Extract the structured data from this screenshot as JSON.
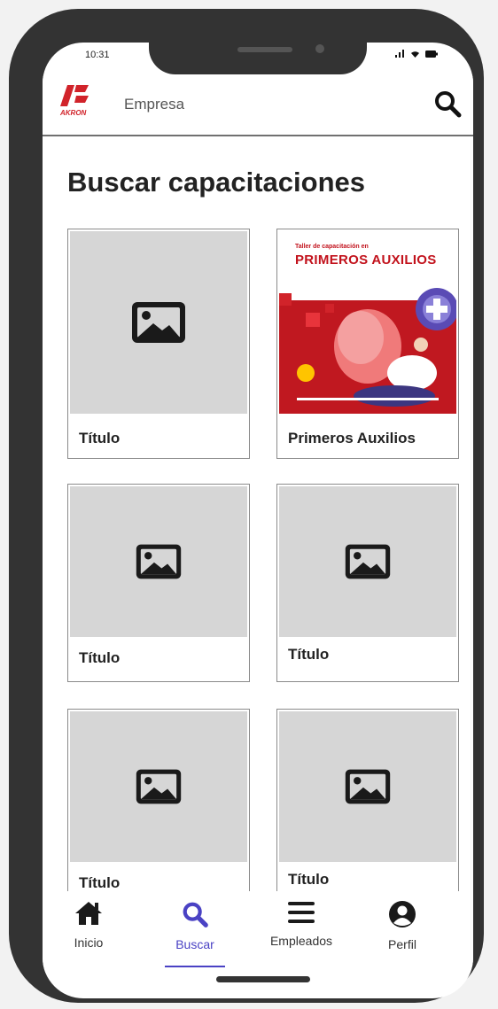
{
  "status_bar": {
    "time": "10:31"
  },
  "header": {
    "company": "Empresa",
    "logo_text": "AKRON"
  },
  "page": {
    "title": "Buscar capacitaciones"
  },
  "cards": [
    {
      "title": "Título"
    },
    {
      "title": "Primeros Auxilios",
      "poster_subtitle": "Taller de capacitación en",
      "poster_title": "PRIMEROS AUXILIOS"
    },
    {
      "title": "Título"
    },
    {
      "title": "Título"
    },
    {
      "title": "Título"
    },
    {
      "title": "Título"
    }
  ],
  "nav": {
    "items": [
      {
        "label": "Inicio",
        "icon": "home-icon"
      },
      {
        "label": "Buscar",
        "icon": "search-icon",
        "active": true
      },
      {
        "label": "Empleados",
        "icon": "list-icon"
      },
      {
        "label": "Perfil",
        "icon": "profile-icon"
      }
    ]
  },
  "colors": {
    "accent": "#4a42c4",
    "brand_red": "#d1232a",
    "placeholder": "#d6d6d6",
    "frame": "#333333"
  }
}
